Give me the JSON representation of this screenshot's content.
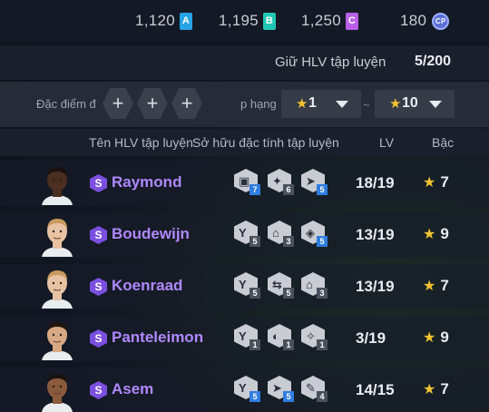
{
  "currencies": [
    {
      "value": "1,120",
      "letter": "A",
      "color": "#27a3e6"
    },
    {
      "value": "1,195",
      "letter": "B",
      "color": "#21c7b5"
    },
    {
      "value": "1,250",
      "letter": "C",
      "color": "#b95fe8"
    }
  ],
  "cp": {
    "value": "180",
    "letter": "CP"
  },
  "summary": {
    "label": "Giữ HLV tập luyện",
    "value": "5/200"
  },
  "filters": {
    "trait_label": "Đặc điểm đ",
    "rank_label": "p hạng",
    "plus": "+",
    "from": "1",
    "to": "10",
    "tilde": "~"
  },
  "columns": {
    "name": "Tên HLV tập luyện",
    "traits": "Sở hữu đặc tính tập luyện",
    "lv": "LV",
    "grade": "Bậc"
  },
  "rows": [
    {
      "name": "Raymond",
      "lv": "18/19",
      "grade": "7",
      "skin": "#4a2e20",
      "hair": "#1a1210",
      "traits": [
        {
          "icon": "shield-trait-icon",
          "level": "7",
          "blue": true
        },
        {
          "icon": "dribble-trait-icon",
          "level": "6",
          "blue": false
        },
        {
          "icon": "sprint-trait-icon",
          "level": "5",
          "blue": true
        }
      ]
    },
    {
      "name": "Boudewijn",
      "lv": "13/19",
      "grade": "9",
      "skin": "#e7c3a4",
      "hair": "#c89a5e",
      "traits": [
        {
          "icon": "strength-trait-icon",
          "level": "5",
          "blue": false
        },
        {
          "icon": "tackle-trait-icon",
          "level": "3",
          "blue": false
        },
        {
          "icon": "defense-trait-icon",
          "level": "5",
          "blue": true
        }
      ]
    },
    {
      "name": "Koenraad",
      "lv": "13/19",
      "grade": "7",
      "skin": "#e7c3a4",
      "hair": "#c89a5e",
      "traits": [
        {
          "icon": "strength-trait-icon",
          "level": "5",
          "blue": false
        },
        {
          "icon": "pass-trait-icon",
          "level": "5",
          "blue": false
        },
        {
          "icon": "tackle-trait-icon",
          "level": "3",
          "blue": false
        }
      ]
    },
    {
      "name": "Panteleimon",
      "lv": "3/19",
      "grade": "9",
      "skin": "#d8a985",
      "hair": "#20160f",
      "traits": [
        {
          "icon": "strength-trait-icon",
          "level": "1",
          "blue": false
        },
        {
          "icon": "header-trait-icon",
          "level": "1",
          "blue": false
        },
        {
          "icon": "shooting-trait-icon",
          "level": "1",
          "blue": false
        }
      ]
    },
    {
      "name": "Asem",
      "lv": "14/15",
      "grade": "7",
      "skin": "#8a5a3c",
      "hair": "#1a1210",
      "traits": [
        {
          "icon": "strength-trait-icon",
          "level": "5",
          "blue": true
        },
        {
          "icon": "sprint-trait-icon",
          "level": "5",
          "blue": true
        },
        {
          "icon": "skill-trait-icon",
          "level": "4",
          "blue": false
        }
      ]
    }
  ]
}
